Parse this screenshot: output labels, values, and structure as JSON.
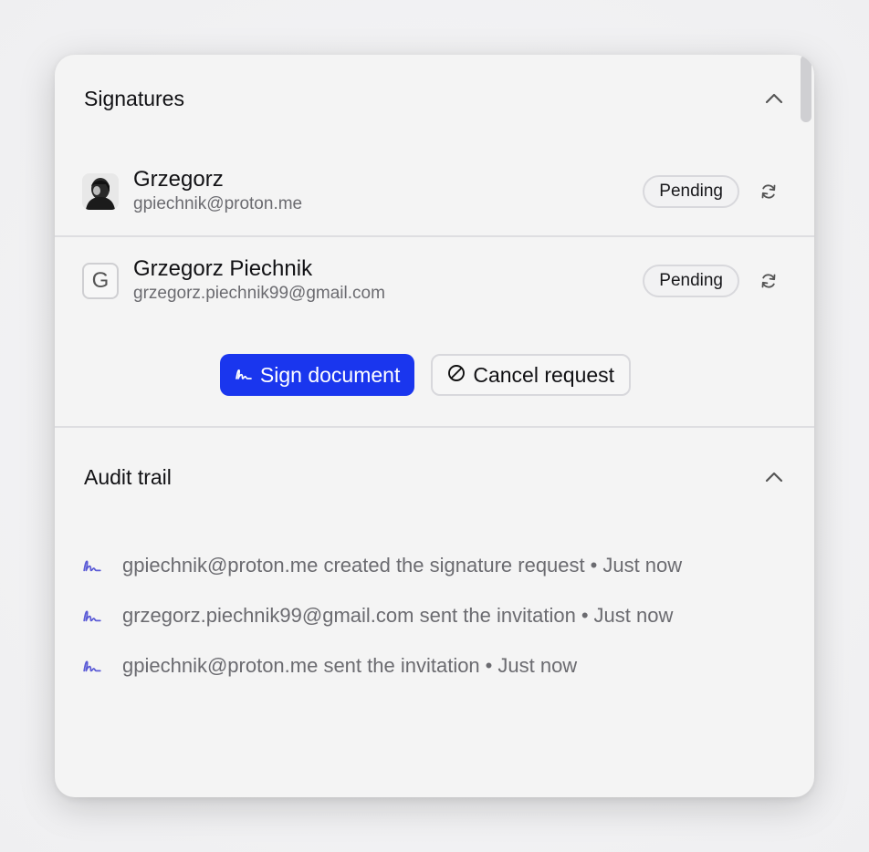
{
  "colors": {
    "accent": "#1a36ee",
    "audit_icon": "#5b5bd6",
    "text_primary": "#111114",
    "text_secondary": "#6b6b70"
  },
  "signatures": {
    "title": "Signatures",
    "collapse_icon": "chevron-up-icon",
    "signers": [
      {
        "name": "Grzegorz",
        "email": "gpiechnik@proton.me",
        "avatar_type": "photo",
        "status": "Pending",
        "action_icon": "refresh-icon"
      },
      {
        "name": "Grzegorz Piechnik",
        "email": "grzegorz.piechnik99@gmail.com",
        "avatar_type": "letter",
        "avatar_letter": "G",
        "status": "Pending",
        "action_icon": "refresh-icon"
      }
    ],
    "actions": {
      "sign_label": "Sign document",
      "sign_icon": "signature-icon",
      "cancel_label": "Cancel request",
      "cancel_icon": "ban-icon"
    }
  },
  "audit": {
    "title": "Audit trail",
    "collapse_icon": "chevron-up-icon",
    "separator": "•",
    "items": [
      {
        "text": "gpiechnik@proton.me created the signature request",
        "time": "Just now"
      },
      {
        "text": "grzegorz.piechnik99@gmail.com sent the invitation",
        "time": "Just now"
      },
      {
        "text": "gpiechnik@proton.me sent the invitation",
        "time": "Just now"
      }
    ]
  }
}
